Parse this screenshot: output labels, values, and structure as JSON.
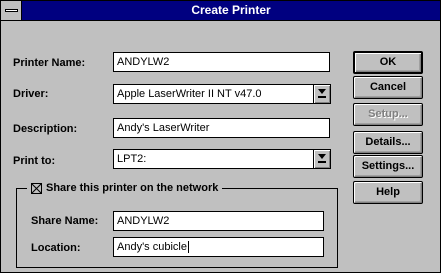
{
  "window": {
    "title": "Create Printer"
  },
  "form": {
    "printer_name": {
      "label": "Printer Name:",
      "value": "ANDYLW2"
    },
    "driver": {
      "label": "Driver:",
      "value": "Apple LaserWriter II NT v47.0"
    },
    "description": {
      "label": "Description:",
      "value": "Andy's LaserWriter"
    },
    "print_to": {
      "label": "Print to:",
      "value": "LPT2:"
    }
  },
  "share": {
    "checkbox_label": "Share this printer on the network",
    "checked": true,
    "share_name": {
      "label": "Share Name:",
      "value": "ANDYLW2"
    },
    "location": {
      "label": "Location:",
      "value": "Andy's cubicle"
    }
  },
  "buttons": {
    "ok": "OK",
    "cancel": "Cancel",
    "setup": "Setup...",
    "details": "Details...",
    "settings": "Settings...",
    "help": "Help"
  },
  "icons": {
    "system_menu": "system-menu-icon",
    "dropdown_arrow": "dropdown-arrow-icon",
    "checkbox_check": "checkmark-x-icon"
  },
  "colors": {
    "title_bar": "#000080",
    "dialog_face": "#c0c0c0",
    "field_background": "#ffffff",
    "disabled_text": "#808080"
  }
}
